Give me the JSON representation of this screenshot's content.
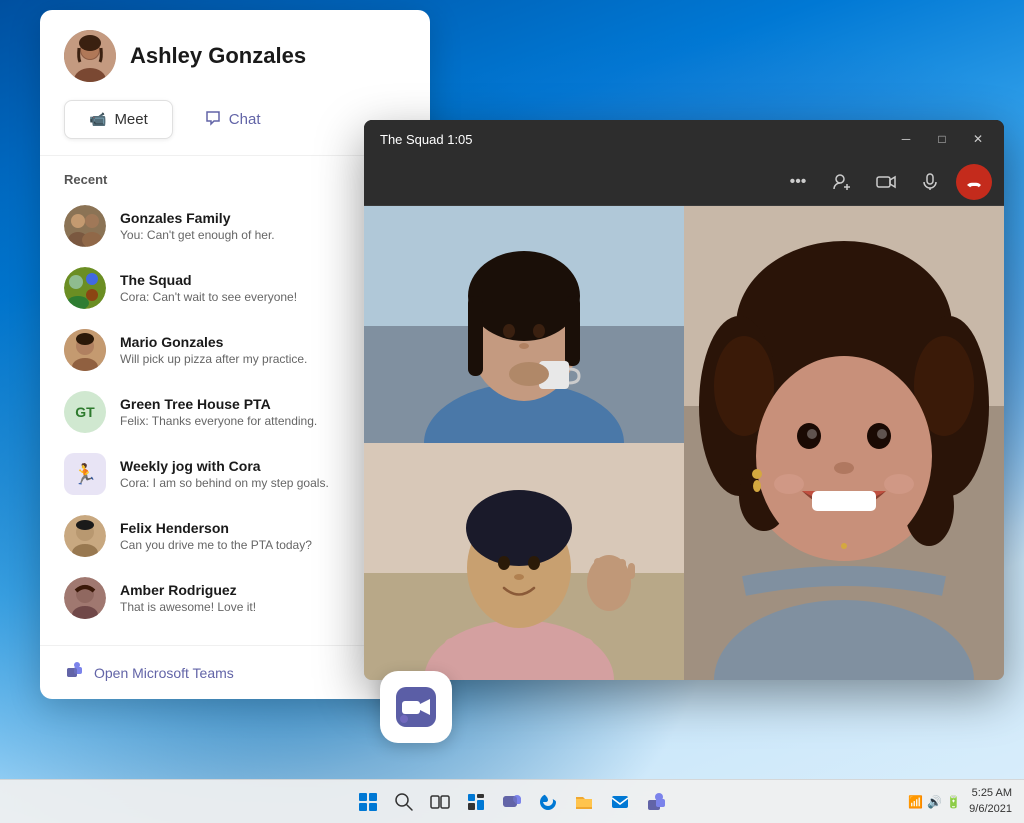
{
  "wallpaper": {
    "style": "Windows 11 blue swirl"
  },
  "chat_panel": {
    "user": {
      "name": "Ashley Gonzales",
      "avatar_type": "photo"
    },
    "tabs": [
      {
        "id": "meet",
        "label": "Meet",
        "icon": "video-icon",
        "active": false
      },
      {
        "id": "chat",
        "label": "Chat",
        "icon": "chat-icon",
        "active": true
      }
    ],
    "recent_label": "Recent",
    "recent_items": [
      {
        "id": "gonzales-family",
        "name": "Gonzales Family",
        "preview": "You: Can't get enough of her.",
        "avatar_type": "group",
        "avatar_bg": "multi"
      },
      {
        "id": "the-squad",
        "name": "The Squad",
        "preview": "Cora: Can't wait to see everyone!",
        "avatar_type": "group",
        "avatar_bg": "multi2"
      },
      {
        "id": "mario-gonzales",
        "name": "Mario Gonzales",
        "preview": "Will pick up pizza after my practice.",
        "avatar_type": "person",
        "avatar_bg": "mario"
      },
      {
        "id": "green-tree-house",
        "name": "Green Tree House PTA",
        "preview": "Felix: Thanks everyone for attending.",
        "avatar_type": "initials",
        "initials": "GT",
        "avatar_bg": "gt"
      },
      {
        "id": "weekly-jog",
        "name": "Weekly jog with Cora",
        "preview": "Cora: I am so behind on my step goals.",
        "avatar_type": "icon",
        "avatar_bg": "weekly"
      },
      {
        "id": "felix-henderson",
        "name": "Felix Henderson",
        "preview": "Can you drive me to the PTA today?",
        "avatar_type": "person",
        "avatar_bg": "felix"
      },
      {
        "id": "amber-rodriguez",
        "name": "Amber Rodriguez",
        "preview": "That is awesome! Love it!",
        "avatar_type": "person",
        "avatar_bg": "amber"
      }
    ],
    "open_teams_label": "Open Microsoft Teams"
  },
  "video_window": {
    "title": "The Squad 1:05",
    "window_controls": [
      "minimize",
      "maximize",
      "close"
    ],
    "toolbar_buttons": [
      "more-options",
      "add-people",
      "video-camera",
      "microphone",
      "end-call"
    ],
    "participants": [
      {
        "id": "p1",
        "description": "Woman drinking coffee",
        "position": "top-left"
      },
      {
        "id": "p2",
        "description": "Man waving",
        "position": "bottom-left"
      },
      {
        "id": "p3",
        "description": "Woman smiling",
        "position": "right-large"
      }
    ]
  },
  "teams_app_icon": {
    "label": "Microsoft Teams",
    "icon": "teams-icon"
  },
  "taskbar": {
    "time": "5:25 AM",
    "date": "9/6/2021",
    "icons": [
      "search",
      "start",
      "task-view",
      "widgets",
      "chat",
      "edge",
      "file-explorer",
      "mail",
      "teams"
    ],
    "systray_icons": [
      "network",
      "volume",
      "battery"
    ]
  }
}
